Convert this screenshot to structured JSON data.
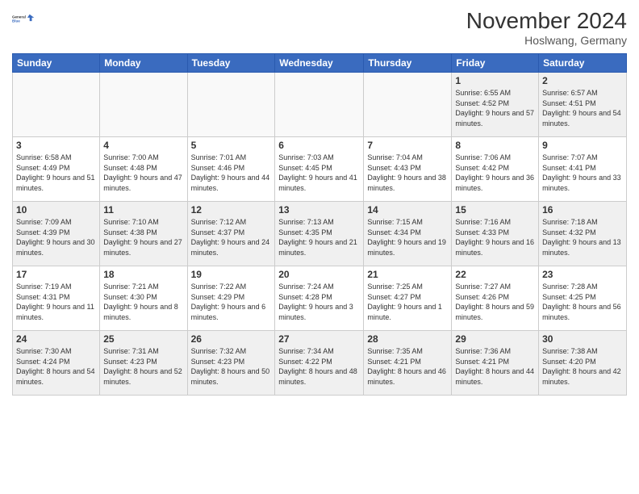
{
  "header": {
    "logo_line1": "General",
    "logo_line2": "Blue",
    "title": "November 2024",
    "subtitle": "Hoslwang, Germany"
  },
  "days_of_week": [
    "Sunday",
    "Monday",
    "Tuesday",
    "Wednesday",
    "Thursday",
    "Friday",
    "Saturday"
  ],
  "weeks": [
    [
      {
        "day": "",
        "info": ""
      },
      {
        "day": "",
        "info": ""
      },
      {
        "day": "",
        "info": ""
      },
      {
        "day": "",
        "info": ""
      },
      {
        "day": "",
        "info": ""
      },
      {
        "day": "1",
        "info": "Sunrise: 6:55 AM\nSunset: 4:52 PM\nDaylight: 9 hours and 57 minutes."
      },
      {
        "day": "2",
        "info": "Sunrise: 6:57 AM\nSunset: 4:51 PM\nDaylight: 9 hours and 54 minutes."
      }
    ],
    [
      {
        "day": "3",
        "info": "Sunrise: 6:58 AM\nSunset: 4:49 PM\nDaylight: 9 hours and 51 minutes."
      },
      {
        "day": "4",
        "info": "Sunrise: 7:00 AM\nSunset: 4:48 PM\nDaylight: 9 hours and 47 minutes."
      },
      {
        "day": "5",
        "info": "Sunrise: 7:01 AM\nSunset: 4:46 PM\nDaylight: 9 hours and 44 minutes."
      },
      {
        "day": "6",
        "info": "Sunrise: 7:03 AM\nSunset: 4:45 PM\nDaylight: 9 hours and 41 minutes."
      },
      {
        "day": "7",
        "info": "Sunrise: 7:04 AM\nSunset: 4:43 PM\nDaylight: 9 hours and 38 minutes."
      },
      {
        "day": "8",
        "info": "Sunrise: 7:06 AM\nSunset: 4:42 PM\nDaylight: 9 hours and 36 minutes."
      },
      {
        "day": "9",
        "info": "Sunrise: 7:07 AM\nSunset: 4:41 PM\nDaylight: 9 hours and 33 minutes."
      }
    ],
    [
      {
        "day": "10",
        "info": "Sunrise: 7:09 AM\nSunset: 4:39 PM\nDaylight: 9 hours and 30 minutes."
      },
      {
        "day": "11",
        "info": "Sunrise: 7:10 AM\nSunset: 4:38 PM\nDaylight: 9 hours and 27 minutes."
      },
      {
        "day": "12",
        "info": "Sunrise: 7:12 AM\nSunset: 4:37 PM\nDaylight: 9 hours and 24 minutes."
      },
      {
        "day": "13",
        "info": "Sunrise: 7:13 AM\nSunset: 4:35 PM\nDaylight: 9 hours and 21 minutes."
      },
      {
        "day": "14",
        "info": "Sunrise: 7:15 AM\nSunset: 4:34 PM\nDaylight: 9 hours and 19 minutes."
      },
      {
        "day": "15",
        "info": "Sunrise: 7:16 AM\nSunset: 4:33 PM\nDaylight: 9 hours and 16 minutes."
      },
      {
        "day": "16",
        "info": "Sunrise: 7:18 AM\nSunset: 4:32 PM\nDaylight: 9 hours and 13 minutes."
      }
    ],
    [
      {
        "day": "17",
        "info": "Sunrise: 7:19 AM\nSunset: 4:31 PM\nDaylight: 9 hours and 11 minutes."
      },
      {
        "day": "18",
        "info": "Sunrise: 7:21 AM\nSunset: 4:30 PM\nDaylight: 9 hours and 8 minutes."
      },
      {
        "day": "19",
        "info": "Sunrise: 7:22 AM\nSunset: 4:29 PM\nDaylight: 9 hours and 6 minutes."
      },
      {
        "day": "20",
        "info": "Sunrise: 7:24 AM\nSunset: 4:28 PM\nDaylight: 9 hours and 3 minutes."
      },
      {
        "day": "21",
        "info": "Sunrise: 7:25 AM\nSunset: 4:27 PM\nDaylight: 9 hours and 1 minute."
      },
      {
        "day": "22",
        "info": "Sunrise: 7:27 AM\nSunset: 4:26 PM\nDaylight: 8 hours and 59 minutes."
      },
      {
        "day": "23",
        "info": "Sunrise: 7:28 AM\nSunset: 4:25 PM\nDaylight: 8 hours and 56 minutes."
      }
    ],
    [
      {
        "day": "24",
        "info": "Sunrise: 7:30 AM\nSunset: 4:24 PM\nDaylight: 8 hours and 54 minutes."
      },
      {
        "day": "25",
        "info": "Sunrise: 7:31 AM\nSunset: 4:23 PM\nDaylight: 8 hours and 52 minutes."
      },
      {
        "day": "26",
        "info": "Sunrise: 7:32 AM\nSunset: 4:23 PM\nDaylight: 8 hours and 50 minutes."
      },
      {
        "day": "27",
        "info": "Sunrise: 7:34 AM\nSunset: 4:22 PM\nDaylight: 8 hours and 48 minutes."
      },
      {
        "day": "28",
        "info": "Sunrise: 7:35 AM\nSunset: 4:21 PM\nDaylight: 8 hours and 46 minutes."
      },
      {
        "day": "29",
        "info": "Sunrise: 7:36 AM\nSunset: 4:21 PM\nDaylight: 8 hours and 44 minutes."
      },
      {
        "day": "30",
        "info": "Sunrise: 7:38 AM\nSunset: 4:20 PM\nDaylight: 8 hours and 42 minutes."
      }
    ]
  ]
}
